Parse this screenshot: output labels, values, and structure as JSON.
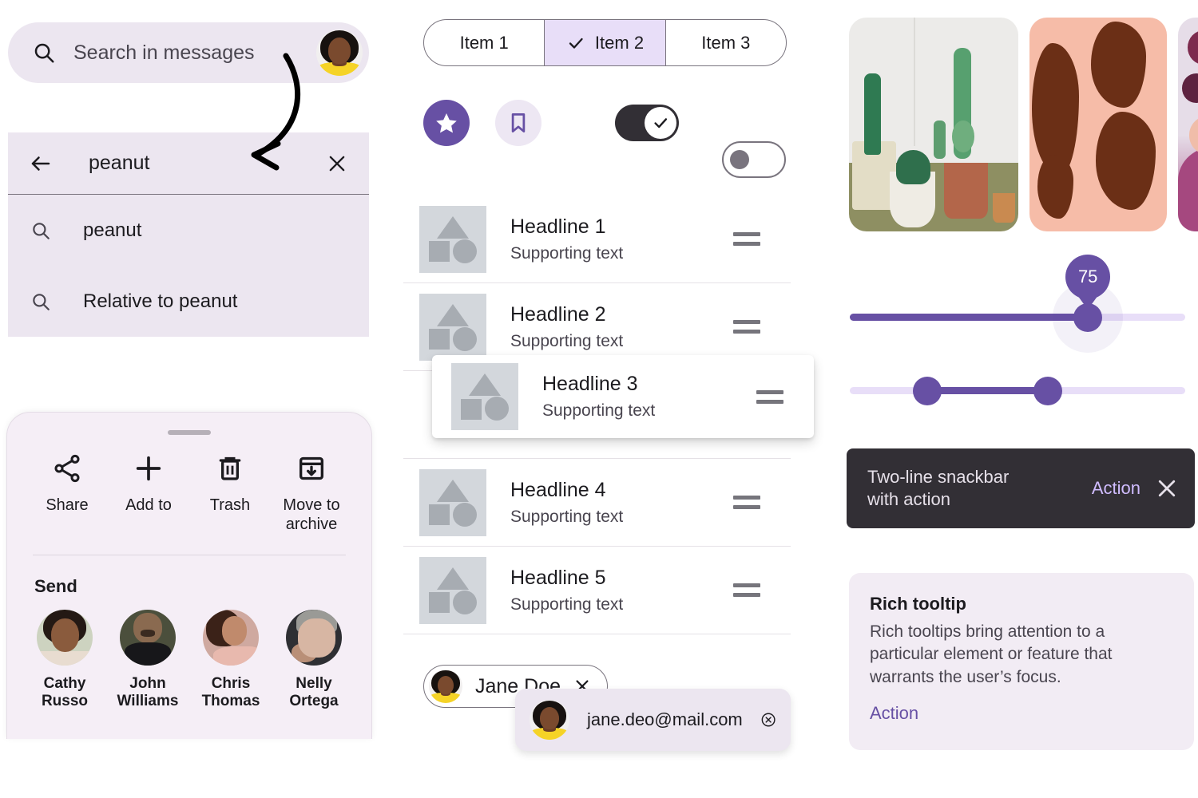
{
  "colors": {
    "primary": "#6750A4",
    "primary_container": "#E8DEF8",
    "surface_variant": "#ECE6F0",
    "on_surface": "#1C1B1F",
    "on_surface_variant": "#49454F",
    "outline": "#79747E",
    "inverse_surface": "#322F35",
    "inverse_primary": "#D0BCFF",
    "placeholder_gray": "#D3D7DC"
  },
  "left_column": {
    "search_bar": {
      "placeholder": "Search in messages",
      "search_icon": "search-icon",
      "avatar_name": "jane-avatar"
    },
    "search_view": {
      "back_icon": "arrow-left-icon",
      "query": "peanut",
      "clear_icon": "close-icon",
      "suggestions": [
        {
          "icon": "search-icon",
          "label": "peanut"
        },
        {
          "icon": "search-icon",
          "label": "Relative to peanut"
        }
      ]
    },
    "annotation": {
      "arrow": "curved-arrow-annotation"
    },
    "bottom_sheet": {
      "drag_handle": "drag-handle",
      "actions": [
        {
          "icon": "share-icon",
          "label": "Share"
        },
        {
          "icon": "plus-icon",
          "label": "Add to"
        },
        {
          "icon": "trash-icon",
          "label": "Trash"
        },
        {
          "icon": "archive-icon",
          "label": "Move to archive"
        }
      ],
      "send_title": "Send",
      "contacts": [
        {
          "name": "Cathy Russo",
          "avatar": "cathy-avatar"
        },
        {
          "name": "John Williams",
          "avatar": "john-avatar"
        },
        {
          "name": "Chris Thomas",
          "avatar": "chris-avatar"
        },
        {
          "name": "Nelly Ortega",
          "avatar": "nelly-avatar"
        }
      ]
    }
  },
  "middle_column": {
    "segmented_button": {
      "items": [
        {
          "label": "Item 1",
          "selected": false
        },
        {
          "label": "Item 2",
          "selected": true
        },
        {
          "label": "Item 3",
          "selected": false
        }
      ],
      "check_icon": "check-icon"
    },
    "controls": [
      {
        "type": "icon-button-filled",
        "icon": "star-icon",
        "state": "selected"
      },
      {
        "type": "icon-button-tonal",
        "icon": "bookmark-icon",
        "state": "unselected"
      },
      {
        "type": "switch",
        "icon": "check-icon",
        "state": "on"
      },
      {
        "type": "switch",
        "icon": "",
        "state": "off"
      }
    ],
    "list": {
      "supporting_text": "Supporting text",
      "drag_handle_icon": "drag-handle-icon",
      "items": [
        {
          "headline": "Headline 1",
          "supporting": "Supporting text"
        },
        {
          "headline": "Headline 2",
          "supporting": "Supporting text"
        },
        {
          "headline": "Headline 4",
          "supporting": "Supporting text"
        },
        {
          "headline": "Headline 5",
          "supporting": "Supporting text"
        }
      ],
      "dragging_item": {
        "headline": "Headline 3",
        "supporting": "Supporting text"
      }
    },
    "chip": {
      "label": "Jane Doe",
      "avatar": "jane-avatar",
      "remove_icon": "close-icon"
    },
    "email_card": {
      "address": "jane.deo@mail.com",
      "avatar": "jane-avatar",
      "remove_icon": "close-circle-icon"
    }
  },
  "right_column": {
    "carousel": [
      {
        "name": "cactus-plants-photo"
      },
      {
        "name": "brown-coral-on-peach-photo"
      },
      {
        "name": "pink-abstract-bubbles-photo"
      }
    ],
    "slider": {
      "value": "75",
      "value_percent": 71,
      "name": "continuous-slider"
    },
    "range_slider": {
      "start_percent": 23,
      "end_percent": 59,
      "name": "range-slider"
    },
    "snackbar": {
      "line1": "Two-line snackbar",
      "line2": "with action",
      "action_label": "Action",
      "close_icon": "close-icon"
    },
    "tooltip": {
      "title": "Rich tooltip",
      "body": "Rich tooltips bring attention to a particular element or feature that warrants the user’s focus.",
      "action_label": "Action"
    }
  }
}
